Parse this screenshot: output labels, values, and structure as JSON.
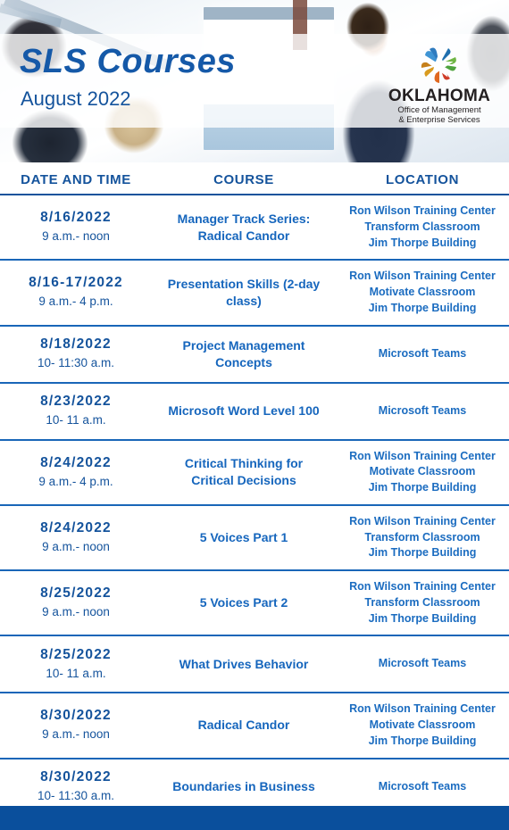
{
  "header": {
    "title": "SLS Courses",
    "subtitle": "August 2022",
    "logo": {
      "state": "OKLAHOMA",
      "line1": "Office of Management",
      "line2": "& Enterprise Services",
      "mark_name": "oklahoma-omes-pinwheel-logo"
    }
  },
  "table": {
    "columns": [
      "DATE AND TIME",
      "COURSE",
      "LOCATION"
    ],
    "rows": [
      {
        "date": "8/16/2022",
        "time": "9 a.m.- noon",
        "course": "Manager Track Series: Radical Candor",
        "location": [
          "Ron Wilson Training Center",
          "Transform Classroom",
          "Jim Thorpe Building"
        ]
      },
      {
        "date": "8/16-17/2022",
        "time": "9 a.m.- 4 p.m.",
        "course": "Presentation Skills (2-day class)",
        "location": [
          "Ron Wilson Training Center",
          "Motivate Classroom",
          "Jim Thorpe Building"
        ]
      },
      {
        "date": "8/18/2022",
        "time": "10- 11:30 a.m.",
        "course": "Project Management Concepts",
        "location": [
          "Microsoft Teams"
        ]
      },
      {
        "date": "8/23/2022",
        "time": "10- 11 a.m.",
        "course": "Microsoft Word Level 100",
        "location": [
          "Microsoft Teams"
        ]
      },
      {
        "date": "8/24/2022",
        "time": "9 a.m.- 4 p.m.",
        "course": "Critical Thinking for Critical Decisions",
        "location": [
          "Ron Wilson Training Center",
          "Motivate Classroom",
          "Jim Thorpe Building"
        ]
      },
      {
        "date": "8/24/2022",
        "time": "9 a.m.- noon",
        "course": "5 Voices Part 1",
        "location": [
          "Ron Wilson Training Center",
          "Transform Classroom",
          "Jim Thorpe Building"
        ]
      },
      {
        "date": "8/25/2022",
        "time": "9 a.m.- noon",
        "course": "5 Voices Part 2",
        "location": [
          "Ron Wilson Training Center",
          "Transform Classroom",
          "Jim Thorpe Building"
        ]
      },
      {
        "date": "8/25/2022",
        "time": "10- 11 a.m.",
        "course": "What Drives Behavior",
        "location": [
          "Microsoft Teams"
        ]
      },
      {
        "date": "8/30/2022",
        "time": "9 a.m.- noon",
        "course": "Radical Candor",
        "location": [
          "Ron Wilson Training Center",
          "Motivate Classroom",
          "Jim Thorpe Building"
        ]
      },
      {
        "date": "8/30/2022",
        "time": "10- 11:30 a.m.",
        "course": "Boundaries in Business",
        "location": [
          "Microsoft Teams"
        ]
      }
    ]
  },
  "colors": {
    "primary_blue": "#14539c",
    "title_blue": "#1559a8",
    "row_rule_blue": "#1966b8",
    "footer_blue": "#0a4f9c",
    "logo_blue": "#2e7bbf",
    "logo_green": "#4ea33e",
    "logo_orange": "#e06820",
    "logo_gold": "#d99b1f",
    "logo_red": "#cf3c28",
    "logo_text": "#231f20"
  }
}
